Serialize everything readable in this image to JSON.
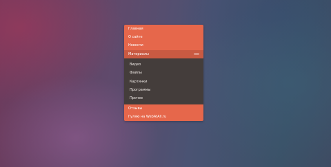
{
  "menu": {
    "items_top": [
      {
        "label": "Главная"
      },
      {
        "label": "О сайте"
      },
      {
        "label": "Новости"
      }
    ],
    "expanded": {
      "label": "Материалы"
    },
    "submenu": [
      {
        "label": "Видео"
      },
      {
        "label": "Файлы"
      },
      {
        "label": "Картинки"
      },
      {
        "label": "Программы"
      },
      {
        "label": "Прочее"
      }
    ],
    "items_bottom": [
      {
        "label": "Отзывы"
      },
      {
        "label": "Гуляю на WebAtAll.ru"
      }
    ]
  },
  "colors": {
    "accent": "#e6674b",
    "submenu_bg": "#443d3b"
  }
}
